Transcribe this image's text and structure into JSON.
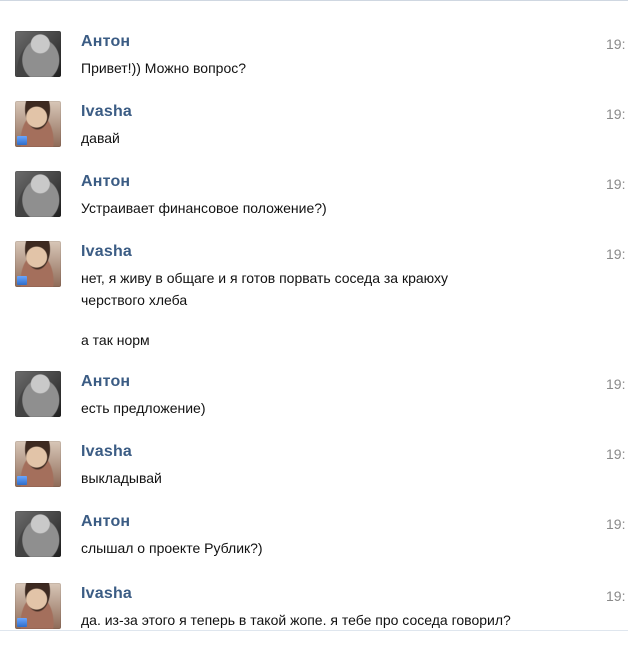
{
  "conversation": {
    "messages": [
      {
        "sender": "Антон",
        "time": "19:",
        "avatar": "anton-avatar",
        "lines": [
          "Привет!)) Можно вопрос?"
        ]
      },
      {
        "sender": "Ivasha",
        "time": "19:",
        "avatar": "ivasha-avatar",
        "lines": [
          "давай"
        ]
      },
      {
        "sender": "Антон",
        "time": "19:",
        "avatar": "anton-avatar",
        "lines": [
          "Устраивает финансовое положение?)"
        ]
      },
      {
        "sender": "Ivasha",
        "time": "19:",
        "avatar": "ivasha-avatar",
        "lines": [
          "нет, я живу в общаге и я готов порвать соседа за краюху\nчерствого хлеба",
          "а так норм"
        ]
      },
      {
        "sender": "Антон",
        "time": "19:",
        "avatar": "anton-avatar",
        "lines": [
          "есть предложение)"
        ]
      },
      {
        "sender": "Ivasha",
        "time": "19:",
        "avatar": "ivasha-avatar",
        "lines": [
          "выкладывай"
        ]
      },
      {
        "sender": "Антон",
        "time": "19:",
        "avatar": "anton-avatar",
        "lines": [
          "слышал о проекте Рублик?)"
        ]
      },
      {
        "sender": "Ivasha",
        "time": "19:",
        "avatar": "ivasha-avatar",
        "lines": [
          "да. из-за этого я теперь в такой жопе. я тебе про соседа говорил?\nну, которого я убить готов за корку хлеба?"
        ]
      }
    ]
  },
  "colors": {
    "sender_name": "#3b5c84",
    "timestamp": "#8a8a8a",
    "message_text": "#111111"
  }
}
